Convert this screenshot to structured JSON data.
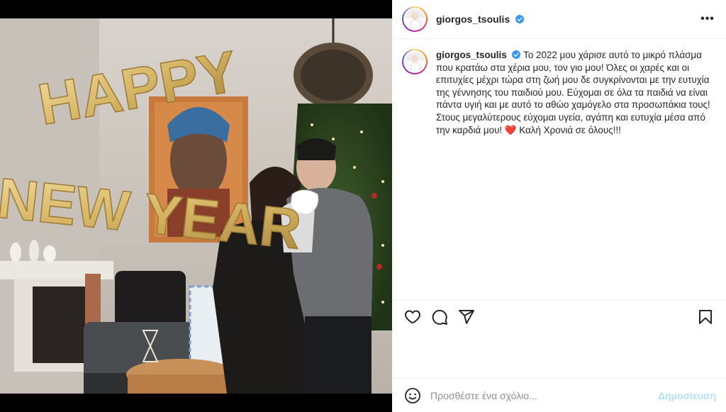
{
  "post": {
    "username": "giorgos_tsoulis",
    "verified": true,
    "more_icon": "more-options-icon",
    "caption_user": "giorgos_tsoulis",
    "caption_text": "Το 2022 μου χάρισε αυτό το μικρό πλάσμα που κρατάω στα χέρια μου, τον γιο μου! Όλες οι χαρές και οι επιτυχίες μέχρι τώρα στη ζωή μου δε συγκρίνονται με την ευτυχία της γέννησης του παιδιού μου. Εύχομαι σε όλα τα παιδιά να είναι πάντα υγιή και με αυτό το αθώο χαμόγελο στα προσωπάκια τους! Στους μεγαλύτερους εύχομαι υγεία, αγάπη και ευτυχία μέσα από την καρδιά μου! ",
    "caption_emoji": "❤️",
    "caption_tail": " Καλή Χρονιά σε όλους!!!"
  },
  "photo": {
    "balloons_line1": "HAPPY",
    "balloons_line2": "NEW YEAR"
  },
  "actions": {
    "like_icon": "heart-icon",
    "comment_icon": "comment-icon",
    "share_icon": "share-icon",
    "save_icon": "bookmark-icon"
  },
  "composer": {
    "placeholder": "Προσθέστε ένα σχόλιο...",
    "post_label": "Δημοσίευση",
    "emoji_icon": "emoji-icon"
  },
  "colors": {
    "verified": "#3897f0",
    "post_button_disabled": "#b2dffc",
    "heart": "#e0245e",
    "balloon_gold": "#d8b96a"
  }
}
